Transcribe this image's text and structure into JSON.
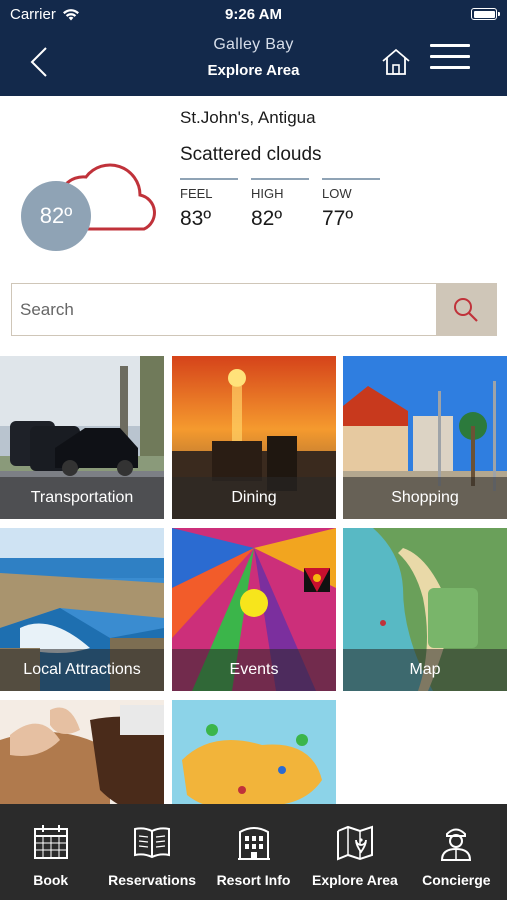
{
  "status": {
    "carrier": "Carrier",
    "time": "9:26 AM"
  },
  "nav": {
    "title": "Galley Bay",
    "subtitle": "Explore Area"
  },
  "weather": {
    "location": "St.John's, Antigua",
    "condition": "Scattered clouds",
    "current_temp": "82º",
    "stats": [
      {
        "label": "FEEL",
        "value": "83º"
      },
      {
        "label": "HIGH",
        "value": "82º"
      },
      {
        "label": "LOW",
        "value": "77º"
      }
    ],
    "accent_color": "#c0323a",
    "circle_color": "#8fa3b5"
  },
  "search": {
    "placeholder": "Search"
  },
  "tiles": [
    {
      "label": "Transportation",
      "icon": "car-photo"
    },
    {
      "label": "Dining",
      "icon": "sunset-dining-photo"
    },
    {
      "label": "Shopping",
      "icon": "shopping-photo"
    },
    {
      "label": "Local Attractions",
      "icon": "coast-photo"
    },
    {
      "label": "Events",
      "icon": "events-art"
    },
    {
      "label": "Map",
      "icon": "resort-map"
    },
    {
      "label": "",
      "icon": "spa-photo"
    },
    {
      "label": "",
      "icon": "antigua-map"
    }
  ],
  "tabs": [
    {
      "label": "Book",
      "icon": "calendar-icon"
    },
    {
      "label": "Reservations",
      "icon": "book-icon"
    },
    {
      "label": "Resort Info",
      "icon": "building-icon"
    },
    {
      "label": "Explore Area",
      "icon": "map-pin-icon"
    },
    {
      "label": "Concierge",
      "icon": "concierge-icon"
    }
  ],
  "colors": {
    "nav_bg": "#13294b",
    "tab_bg": "#2b2b2b",
    "search_btn": "#cfc6b8"
  }
}
